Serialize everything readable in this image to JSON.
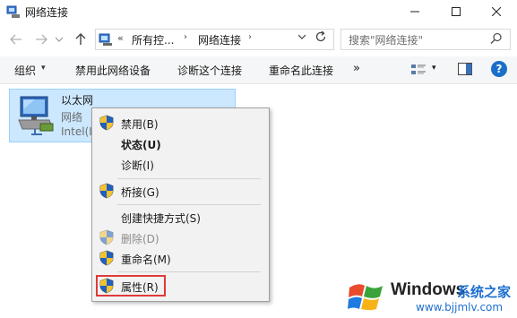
{
  "window": {
    "title": "网络连接"
  },
  "address_bar": {
    "overflow_chevron": "«",
    "crumbs": [
      "所有控...",
      "网络连接"
    ],
    "separator": "›",
    "search_placeholder": "搜索\"网络连接\""
  },
  "command_bar": {
    "organize": "组织",
    "organize_arrow": "▾",
    "disable_device": "禁用此网络设备",
    "diagnose": "诊断这个连接",
    "rename": "重命名此连接",
    "more": "»",
    "view_arrow": "▾",
    "help": "?"
  },
  "network_item": {
    "name": "以太网",
    "status": "网络",
    "device": "Intel(I"
  },
  "context_menu": {
    "items": [
      {
        "label": "禁用(B)",
        "shield": true
      },
      {
        "label": "状态(U)",
        "bold": true
      },
      {
        "label": "诊断(I)"
      },
      {
        "label": "桥接(G)",
        "shield": true
      },
      {
        "label": "创建快捷方式(S)"
      },
      {
        "label": "删除(D)",
        "shield": true,
        "disabled": true
      },
      {
        "label": "重命名(M)",
        "shield": true
      },
      {
        "label": "属性(R)",
        "shield": true,
        "highlighted": true
      }
    ]
  },
  "watermark": {
    "title": "Windows",
    "subtitle": "系统之家",
    "url": "www.bjjmlv.com"
  },
  "colors": {
    "selection_bg": "#cce8ff",
    "highlight_border": "#e03a3a",
    "accent_blue": "#1a6fc9"
  }
}
